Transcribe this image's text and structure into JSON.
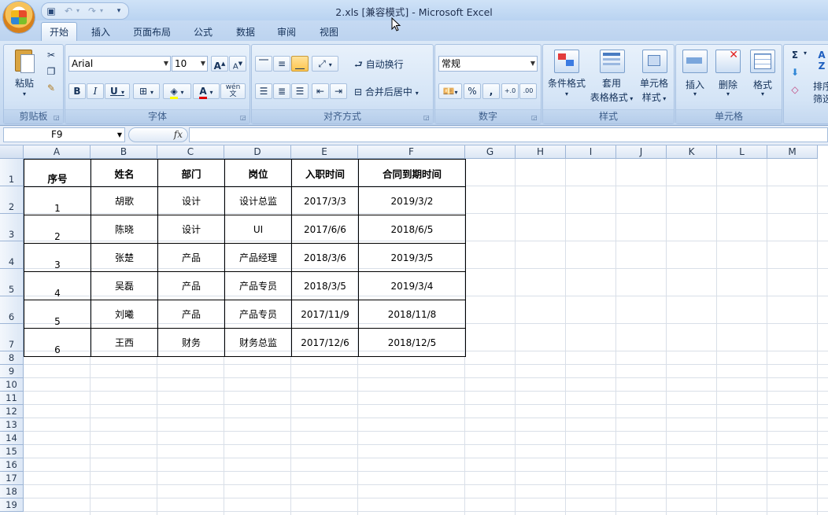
{
  "window": {
    "title": "2.xls  [兼容模式] - Microsoft Excel"
  },
  "ribbon_tabs": [
    "开始",
    "插入",
    "页面布局",
    "公式",
    "数据",
    "审阅",
    "视图"
  ],
  "ribbon": {
    "clipboard": {
      "label": "剪贴板",
      "paste": "粘贴"
    },
    "font": {
      "label": "字体",
      "font_name": "Arial",
      "font_size": "10",
      "bold": "B",
      "italic": "I",
      "underline": "U",
      "grow": "A",
      "shrink": "A",
      "phonetic": "wén 文"
    },
    "alignment": {
      "label": "对齐方式",
      "wrap_text": "自动换行",
      "merge_center": "合并后居中"
    },
    "number": {
      "label": "数字",
      "format": "常规",
      "percent": "%",
      "comma": ","
    },
    "styles": {
      "label": "样式",
      "conditional": "条件格式",
      "table_line1": "套用",
      "table_line2": "表格格式",
      "cell_line1": "单元格",
      "cell_line2": "样式"
    },
    "cells": {
      "label": "单元格",
      "insert": "插入",
      "delete": "删除",
      "format": "格式"
    },
    "editing": {
      "sigma": "Σ",
      "sort_line1": "排序",
      "sort_line2": "筛选"
    }
  },
  "formula_bar": {
    "name_box": "F9",
    "fx": "fx",
    "content": ""
  },
  "sheet": {
    "columns": [
      "A",
      "B",
      "C",
      "D",
      "E",
      "F",
      "G",
      "H",
      "I",
      "J",
      "K",
      "L",
      "M"
    ],
    "rows": [
      "1",
      "2",
      "3",
      "4",
      "5",
      "6",
      "7",
      "8",
      "9",
      "10",
      "11",
      "12",
      "13",
      "14",
      "15",
      "16",
      "17",
      "18",
      "19"
    ],
    "table": {
      "headers": [
        "序号",
        "姓名",
        "部门",
        "岗位",
        "入职时间",
        "合同到期时间"
      ],
      "rows": [
        [
          "1",
          "胡歌",
          "设计",
          "设计总监",
          "2017/3/3",
          "2019/3/2"
        ],
        [
          "2",
          "陈晓",
          "设计",
          "UI",
          "2017/6/6",
          "2018/6/5"
        ],
        [
          "3",
          "张楚",
          "产品",
          "产品经理",
          "2018/3/6",
          "2019/3/5"
        ],
        [
          "4",
          "吴磊",
          "产品",
          "产品专员",
          "2018/3/5",
          "2019/3/4"
        ],
        [
          "5",
          "刘曦",
          "产品",
          "产品专员",
          "2017/11/9",
          "2018/11/8"
        ],
        [
          "6",
          "王西",
          "财务",
          "财务总监",
          "2017/12/6",
          "2018/12/5"
        ]
      ]
    }
  }
}
